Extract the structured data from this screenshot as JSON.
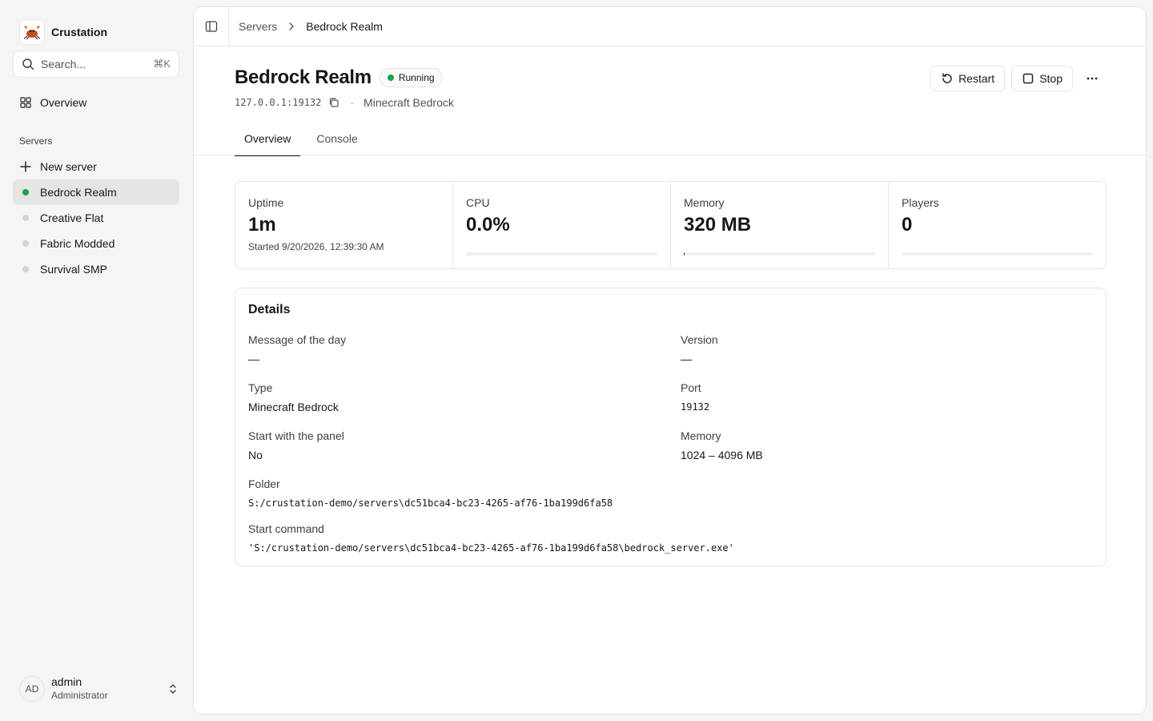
{
  "app": {
    "name": "Crustation"
  },
  "search": {
    "placeholder": "Search...",
    "shortcut": "⌘K"
  },
  "sidebar": {
    "overview": "Overview",
    "group_label": "Servers",
    "new_server": "New server",
    "servers": [
      {
        "name": "Bedrock Realm",
        "status": "running"
      },
      {
        "name": "Creative Flat",
        "status": "stopped"
      },
      {
        "name": "Fabric Modded",
        "status": "stopped"
      },
      {
        "name": "Survival SMP",
        "status": "stopped"
      }
    ]
  },
  "user": {
    "initials": "AD",
    "name": "admin",
    "role": "Administrator"
  },
  "breadcrumb": {
    "parent": "Servers",
    "current": "Bedrock Realm"
  },
  "server": {
    "name": "Bedrock Realm",
    "status": "Running",
    "address": "127.0.0.1:19132",
    "separator": "·",
    "type": "Minecraft Bedrock"
  },
  "actions": {
    "restart": "Restart",
    "stop": "Stop"
  },
  "tabs": [
    {
      "label": "Overview"
    },
    {
      "label": "Console"
    }
  ],
  "stats": {
    "uptime": {
      "label": "Uptime",
      "value": "1m",
      "sub": "Started 9/20/2026, 12:39:30 AM"
    },
    "cpu": {
      "label": "CPU",
      "value": "0.0%",
      "fraction": 0.0
    },
    "memory": {
      "label": "Memory",
      "value": "320 MB",
      "fraction": 0.005
    },
    "players": {
      "label": "Players",
      "value": "0",
      "fraction": 0.0
    }
  },
  "details": {
    "title": "Details",
    "motd_label": "Message of the day",
    "motd": "—",
    "version_label": "Version",
    "version": "—",
    "type_label": "Type",
    "type": "Minecraft Bedrock",
    "port_label": "Port",
    "port": "19132",
    "start_panel_label": "Start with the panel",
    "start_panel": "No",
    "memory_label": "Memory",
    "memory": "1024 – 4096 MB",
    "folder_label": "Folder",
    "folder": "S:/crustation-demo/servers\\dc51bca4-bc23-4265-af76-1ba199d6fa58",
    "command_label": "Start command",
    "command": "'S:/crustation-demo/servers\\dc51bca4-bc23-4265-af76-1ba199d6fa58\\bedrock_server.exe'"
  }
}
